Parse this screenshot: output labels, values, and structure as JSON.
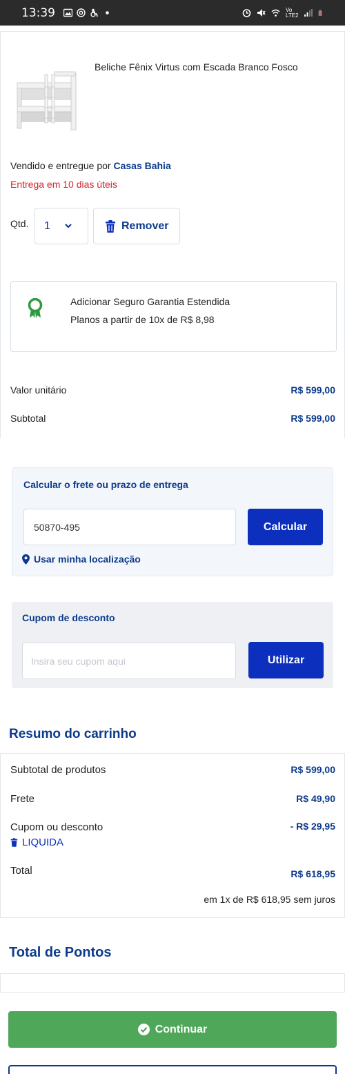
{
  "status_bar": {
    "time": "13:39",
    "network": "Vo LTE2"
  },
  "product": {
    "name": "Beliche Fênix Virtus com Escada Branco Fosco",
    "sold_by_prefix": "Vendido e entregue por",
    "seller": "Casas Bahia",
    "delivery": "Entrega em 10 dias úteis",
    "qty_label": "Qtd.",
    "qty_value": "1",
    "remove_label": "Remover"
  },
  "warranty": {
    "line1": "Adicionar Seguro Garantia Estendida",
    "line2": "Planos a partir de 10x de R$ 8,98"
  },
  "item_prices": {
    "unit_label": "Valor unitário",
    "unit_value": "R$ 599,00",
    "subtotal_label": "Subtotal",
    "subtotal_value": "R$ 599,00"
  },
  "freight": {
    "title": "Calcular o frete ou prazo de entrega",
    "cep_value": "50870-495",
    "calc_label": "Calcular",
    "location_label": "Usar minha localização"
  },
  "coupon": {
    "title": "Cupom de desconto",
    "placeholder": "Insira seu cupom aqui",
    "apply_label": "Utilizar"
  },
  "summary": {
    "title": "Resumo do carrinho",
    "products_label": "Subtotal de produtos",
    "products_value": "R$ 599,00",
    "freight_label": "Frete",
    "freight_value": "R$ 49,90",
    "discount_label": "Cupom ou desconto",
    "discount_value": "- R$ 29,95",
    "coupon_code": "LIQUIDA",
    "total_label": "Total",
    "total_value": "R$ 618,95",
    "installments": "em 1x de R$ 618,95 sem juros"
  },
  "points": {
    "title": "Total de Pontos"
  },
  "actions": {
    "continue_label": "Continuar"
  },
  "colors": {
    "brand_blue": "#0c3a8c",
    "button_blue": "#0d2fbe",
    "delivery_red": "#d0262d",
    "continue_green": "#4fa75a",
    "ribbon_green": "#2e9b3f"
  },
  "icons": {
    "trash": "trash-icon",
    "ribbon": "award-ribbon-icon",
    "pin": "location-pin-icon",
    "check": "check-circle-icon",
    "chevron": "chevron-down-icon"
  }
}
